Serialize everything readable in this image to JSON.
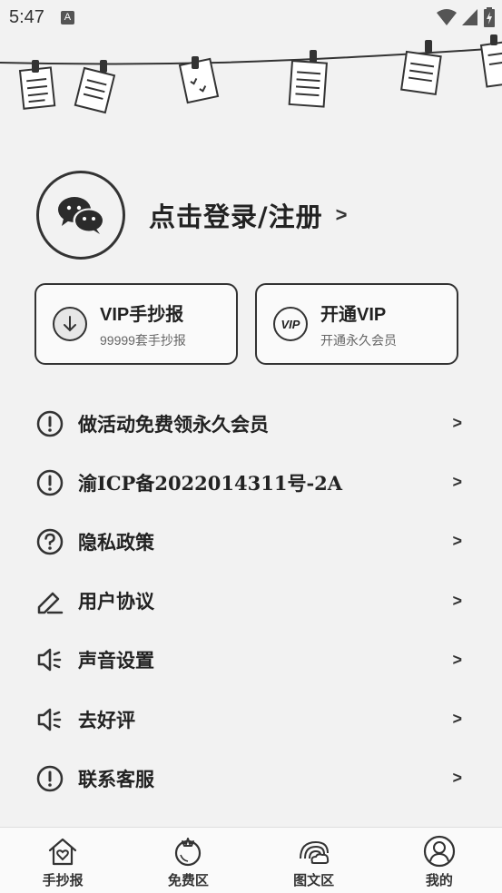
{
  "status_bar": {
    "time": "5:47",
    "notification_icon": "A"
  },
  "profile": {
    "login_label": "点击登录/注册",
    "arrow": ">"
  },
  "cards": [
    {
      "title": "VIP手抄报",
      "subtitle": "99999套手抄报",
      "icon": "download-icon"
    },
    {
      "title": "开通VIP",
      "subtitle": "开通永久会员",
      "icon": "vip-icon",
      "icon_text": "VIP"
    }
  ],
  "menu": [
    {
      "label": "做活动免费领永久会员",
      "icon": "exclamation-icon"
    },
    {
      "label": "渝ICP备2022014311号-2A",
      "icon": "exclamation-icon"
    },
    {
      "label": "隐私政策",
      "icon": "question-icon"
    },
    {
      "label": "用户协议",
      "icon": "pencil-icon"
    },
    {
      "label": "声音设置",
      "icon": "speaker-icon"
    },
    {
      "label": "去好评",
      "icon": "speaker-icon"
    },
    {
      "label": "联系客服",
      "icon": "exclamation-icon"
    }
  ],
  "menu_chevron": ">",
  "tabs": [
    {
      "label": "手抄报",
      "icon": "house-heart-icon",
      "active": false
    },
    {
      "label": "免费区",
      "icon": "tomato-icon",
      "active": false
    },
    {
      "label": "图文区",
      "icon": "rainbow-cloud-icon",
      "active": false
    },
    {
      "label": "我的",
      "icon": "user-icon",
      "active": true
    }
  ]
}
